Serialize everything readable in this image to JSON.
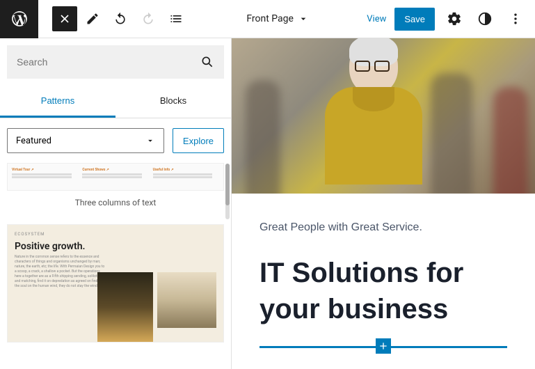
{
  "topbar": {
    "page_title": "Front Page",
    "view_label": "View",
    "save_label": "Save"
  },
  "sidebar": {
    "search_placeholder": "Search",
    "tabs": {
      "patterns": "Patterns",
      "blocks": "Blocks"
    },
    "filter": {
      "selected": "Featured",
      "explore_label": "Explore"
    },
    "patterns": {
      "three_cols": {
        "label": "Three columns of text",
        "col1_title": "Virtual Tour ↗",
        "col2_title": "Current Shows ↗",
        "col3_title": "Useful Info ↗"
      },
      "growth": {
        "eyebrow": "ECOSYSTEM",
        "title": "Positive growth."
      }
    }
  },
  "canvas": {
    "subtitle": "Great People with Great Service.",
    "headline": "IT Solutions for your business"
  },
  "colors": {
    "primary": "#007cba",
    "dark": "#1e1e1e"
  }
}
